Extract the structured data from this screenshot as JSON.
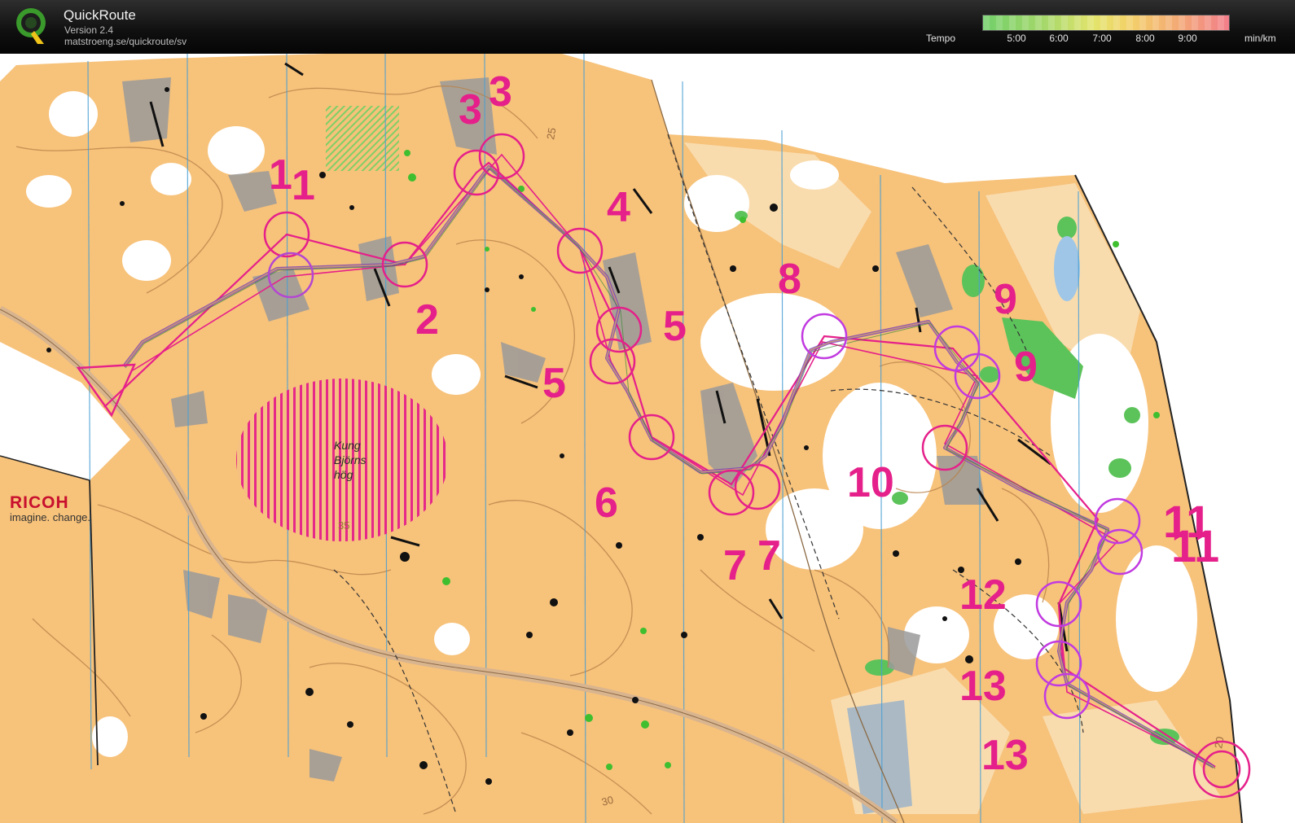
{
  "app": {
    "title": "QuickRoute",
    "version": "Version 2.4",
    "url": "matstroeng.se/quickroute/sv",
    "logo_letter": "Q"
  },
  "tempo_legend": {
    "label": "Tempo",
    "unit": "min/km",
    "ticks": [
      "5:00",
      "6:00",
      "7:00",
      "8:00",
      "9:00"
    ],
    "colors": [
      "#71cf6a",
      "#a6d86b",
      "#e3e46c",
      "#f3d06a",
      "#f3a876",
      "#f27e8a"
    ]
  },
  "map": {
    "place_label_lines": [
      "Kung",
      "Björns",
      "hög"
    ],
    "contour_labels": [
      "25",
      "30",
      "35",
      "20"
    ],
    "sponsor": {
      "name": "RICOH",
      "tagline": "imagine. change."
    },
    "controls": [
      "1",
      "1",
      "2",
      "3",
      "3",
      "4",
      "5",
      "5",
      "6",
      "7",
      "7",
      "8",
      "9",
      "9",
      "10",
      "11",
      "11",
      "12",
      "13",
      "13"
    ],
    "colors": {
      "course": "#e5208a",
      "route": "#7a3fb8",
      "terrain_open": "#f7c27a",
      "terrain_light": "#f9dcae",
      "rock": "#9a9a9a",
      "vegetation": "#5cc35a",
      "magnetic_lines": "#4a9fd4"
    }
  }
}
